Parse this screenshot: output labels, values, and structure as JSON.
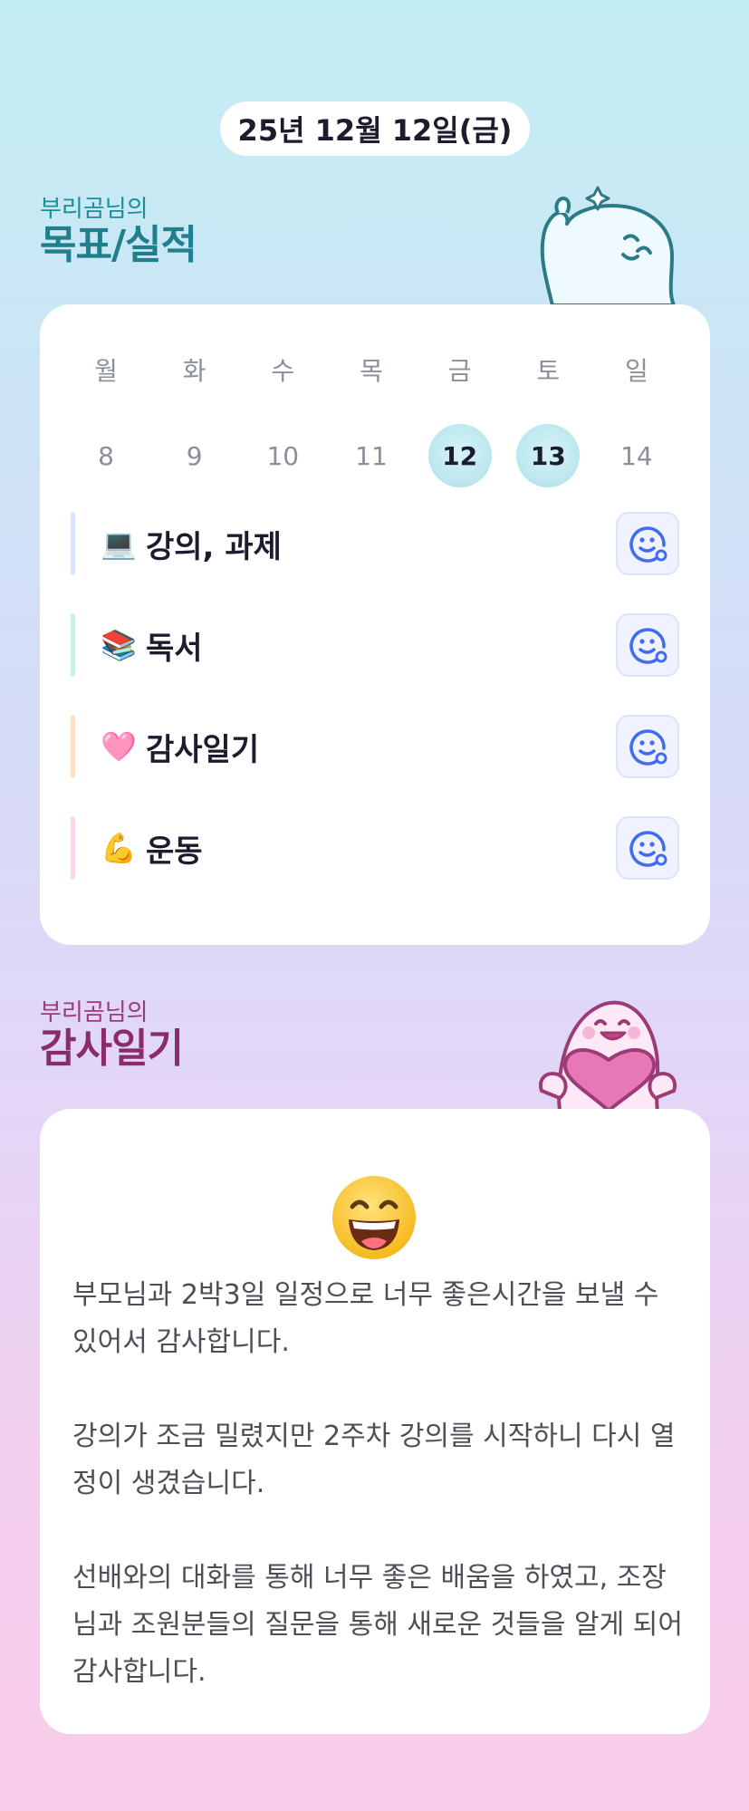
{
  "header": {
    "date": "25년 12월 12일(금)"
  },
  "goals_section": {
    "subtitle": "부리곰님의",
    "title": "목표/실적"
  },
  "week": {
    "weekdays": [
      "월",
      "화",
      "수",
      "목",
      "금",
      "토",
      "일"
    ],
    "days": [
      "8",
      "9",
      "10",
      "11",
      "12",
      "13",
      "14"
    ],
    "highlighted": [
      "12",
      "13"
    ]
  },
  "goals": [
    {
      "emoji": "💻",
      "label": "강의, 과제",
      "bar_color": "#dbe4fb"
    },
    {
      "emoji": "📚",
      "label": "독서",
      "bar_color": "#c9f0e4"
    },
    {
      "emoji": "🩷",
      "label": "감사일기",
      "bar_color": "#ffe3c7"
    },
    {
      "emoji": "💪",
      "label": "운동",
      "bar_color": "#f8d6ec"
    }
  ],
  "gratitude_section": {
    "subtitle": "부리곰님의",
    "title": "감사일기"
  },
  "gratitude": {
    "mood_icon": "grinning-face-icon",
    "paragraphs": [
      "부모님과 2박3일 일정으로 너무 좋은시간을 보낼 수 있어서 감사합니다.",
      "강의가 조금 밀렸지만 2주차 강의를 시작하니 다시 열정이 생겼습니다.",
      "선배와의 대화를 통해 너무 좋은 배움을 하였고, 조장님과 조원분들의 질문을 통해 새로운 것들을 알게 되어 감사합니다."
    ]
  },
  "colors": {
    "accent_teal": "#1f7f8c",
    "accent_plum": "#8a2c67",
    "check_blue": "#3f6df2"
  }
}
